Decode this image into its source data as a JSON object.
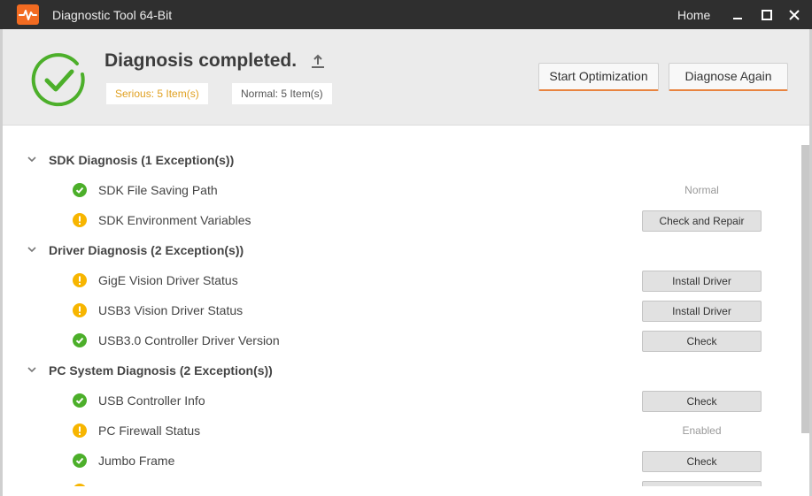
{
  "window": {
    "title": "Diagnostic Tool 64-Bit",
    "home_label": "Home",
    "accent_color": "#f26b21"
  },
  "summary": {
    "title": "Diagnosis completed.",
    "serious_label": "Serious: 5 Item(s)",
    "normal_label": "Normal: 5 Item(s)",
    "start_optimization_label": "Start Optimization",
    "diagnose_again_label": "Diagnose Again"
  },
  "groups": [
    {
      "title": "SDK Diagnosis (1 Exception(s))",
      "items": [
        {
          "label": " SDK File Saving Path",
          "status_icon": "check-icon",
          "status_text": "Normal",
          "action": ""
        },
        {
          "label": "SDK Environment Variables",
          "status_icon": "warning-icon",
          "status_text": "",
          "action": "Check and Repair"
        }
      ]
    },
    {
      "title": "Driver Diagnosis (2 Exception(s))",
      "items": [
        {
          "label": "GigE Vision Driver Status",
          "status_icon": "warning-icon",
          "status_text": "",
          "action": "Install Driver"
        },
        {
          "label": "USB3 Vision Driver Status",
          "status_icon": "warning-icon",
          "status_text": "",
          "action": "Install Driver"
        },
        {
          "label": "USB3.0 Controller Driver Version",
          "status_icon": "check-icon",
          "status_text": "",
          "action": "Check"
        }
      ]
    },
    {
      "title": "PC System Diagnosis (2 Exception(s))",
      "items": [
        {
          "label": "USB Controller Info",
          "status_icon": "check-icon",
          "status_text": "",
          "action": "Check"
        },
        {
          "label": "PC Firewall Status",
          "status_icon": "warning-icon",
          "status_text": "Enabled",
          "action": ""
        },
        {
          "label": "Jumbo Frame",
          "status_icon": "check-icon",
          "status_text": "",
          "action": "Check"
        }
      ]
    }
  ],
  "colors": {
    "ok": "#4caf2a",
    "warn": "#f7b500",
    "serious_text": "#e0a020"
  }
}
